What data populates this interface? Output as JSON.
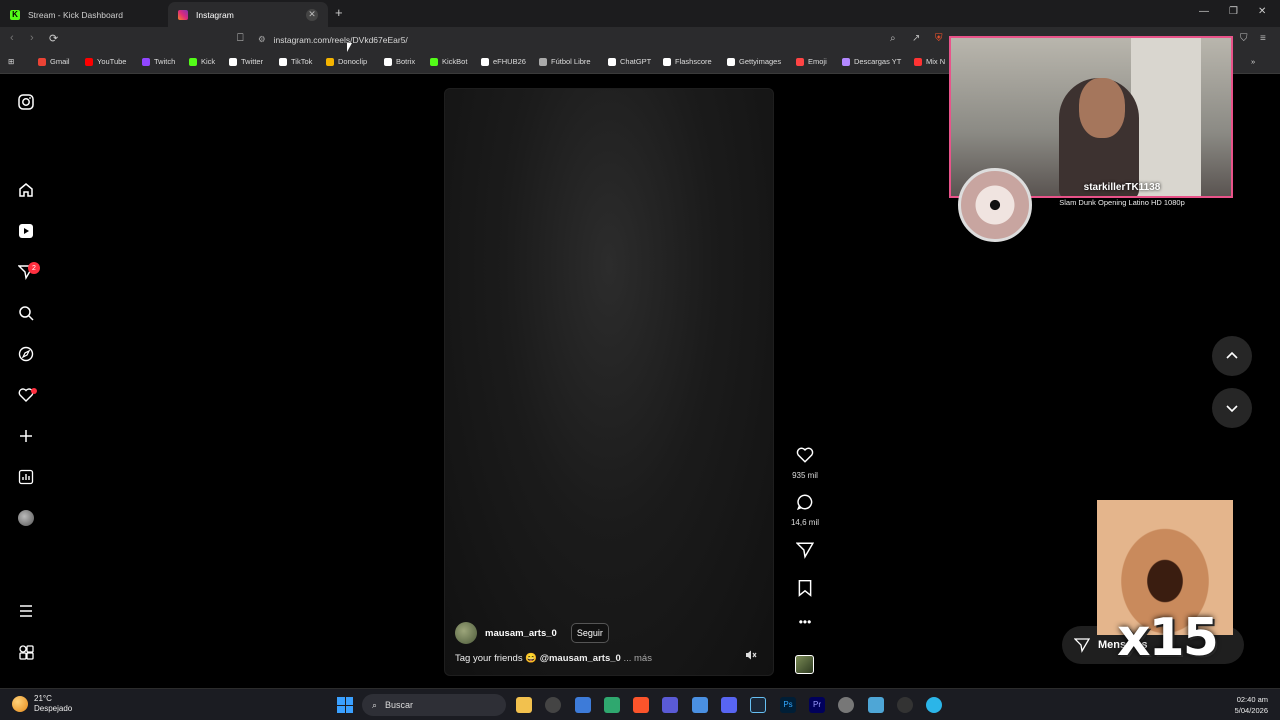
{
  "browser": {
    "tabs": [
      {
        "title": "Stream - Kick Dashboard",
        "favicon": "kick-icon",
        "color": "#53fc18"
      },
      {
        "title": "Instagram",
        "favicon": "instagram-icon",
        "color": "#e1306c"
      }
    ],
    "url": "instagram.com/reels/DVkd67eEar5/",
    "bookmarks": [
      {
        "label": "Gmail",
        "color": "#ea4335"
      },
      {
        "label": "YouTube",
        "color": "#ff0000"
      },
      {
        "label": "Twitch",
        "color": "#9146ff"
      },
      {
        "label": "Kick",
        "color": "#53fc18"
      },
      {
        "label": "Twitter",
        "color": "#ffffff"
      },
      {
        "label": "TikTok",
        "color": "#ffffff"
      },
      {
        "label": "Donoclip",
        "color": "#f5b400"
      },
      {
        "label": "Botrix",
        "color": "#ffffff"
      },
      {
        "label": "KickBot",
        "color": "#53fc18"
      },
      {
        "label": "eFHUB26",
        "color": "#ffffff"
      },
      {
        "label": "Fútbol Libre",
        "color": "#aaaaaa"
      },
      {
        "label": "ChatGPT",
        "color": "#ffffff"
      },
      {
        "label": "Flashscore",
        "color": "#ffffff"
      },
      {
        "label": "Gettyimages",
        "color": "#ffffff"
      },
      {
        "label": "Emoji",
        "color": "#ff4444"
      },
      {
        "label": "Descargas YT",
        "color": "#b388ff"
      },
      {
        "label": "Mix N",
        "color": "#ff3333"
      }
    ]
  },
  "sidebar": {
    "notifications_badge": "2"
  },
  "reel": {
    "username": "mausam_arts_0",
    "follow_label": "Seguir",
    "caption_text": "Tag your friends 😄",
    "caption_mention": "@mausam_arts_0",
    "caption_more": "... más",
    "likes": "935 mil",
    "comments": "14,6 mil"
  },
  "overlay": {
    "streamer_name": "starkillerTK1138",
    "now_playing": "Slam Dunk Opening Latino HD 1080p",
    "meme_counter": "x15",
    "messages_label": "Mensajes"
  },
  "taskbar": {
    "temperature": "21°C",
    "weather": "Despejado",
    "search_placeholder": "Buscar",
    "time": "02:40 am",
    "date": "5/04/2026"
  }
}
